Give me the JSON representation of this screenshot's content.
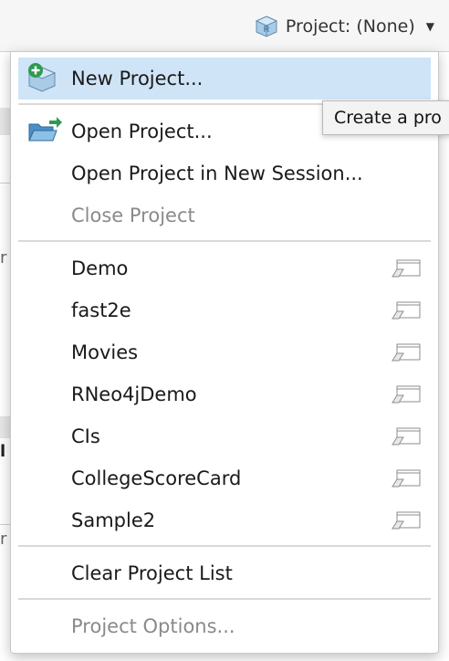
{
  "toolbar": {
    "project_label": "Project: (None)",
    "project_icon": "r-project-cube-icon",
    "caret_icon": "caret-down-icon"
  },
  "menu": {
    "new_project": "New Project...",
    "open_project": "Open Project...",
    "open_new_session": "Open Project in New Session...",
    "close_project": "Close Project",
    "recent_projects": [
      "Demo",
      "fast2e",
      "Movies",
      "RNeo4jDemo",
      "CIs",
      "CollegeScoreCard",
      "Sample2"
    ],
    "clear_list": "Clear Project List",
    "project_options": "Project Options..."
  },
  "tooltip": {
    "text": "Create a pro"
  },
  "colors": {
    "highlight": "#cfe4f7",
    "disabled_text": "#8a8a8a"
  }
}
